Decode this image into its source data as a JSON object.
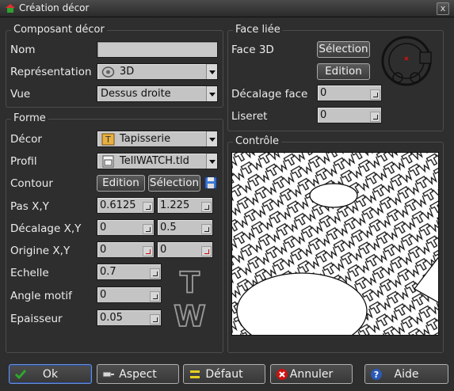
{
  "window": {
    "title": "Création décor",
    "close_label": "x"
  },
  "composant": {
    "legend": "Composant décor",
    "nom_label": "Nom",
    "nom_value": "",
    "representation_label": "Représentation",
    "representation_value": "3D",
    "vue_label": "Vue",
    "vue_value": "Dessus droite"
  },
  "forme": {
    "legend": "Forme",
    "decor_label": "Décor",
    "decor_value": "Tapisserie",
    "profil_label": "Profil",
    "profil_value": "TellWATCH.tld",
    "contour_label": "Contour",
    "edition_label": "Edition",
    "selection_label": "Sélection",
    "pas_label": "Pas X,Y",
    "pas_x": "0.6125",
    "pas_y": "1.225",
    "decalage_label": "Décalage X,Y",
    "decalage_x": "0",
    "decalage_y": "0.5",
    "origine_label": "Origine X,Y",
    "origine_x": "0",
    "origine_y": "0",
    "echelle_label": "Echelle",
    "echelle_value": "0.7",
    "angle_label": "Angle motif",
    "angle_value": "0",
    "epaisseur_label": "Epaisseur",
    "epaisseur_value": "0.05",
    "logo_letters": [
      "T",
      "W"
    ]
  },
  "face": {
    "legend": "Face liée",
    "face3d_label": "Face 3D",
    "selection_label": "Sélection",
    "edition_label": "Edition",
    "decalage_label": "Décalage face",
    "decalage_value": "0",
    "liseret_label": "Liseret",
    "liseret_value": "0"
  },
  "controle": {
    "legend": "Contrôle"
  },
  "buttons": {
    "ok": "Ok",
    "aspect": "Aspect",
    "defaut": "Défaut",
    "annuler": "Annuler",
    "aide": "Aide"
  },
  "colors": {
    "background": "#2e2e2e",
    "field": "#c4c4c4",
    "ok_icon": "#2ea82e",
    "cancel_icon": "#d01010",
    "help_icon": "#2a5ab8",
    "default_icon": "#e6d020"
  },
  "icons": [
    "app-icon",
    "close-icon",
    "3d-icon",
    "tapisserie-icon",
    "profil-icon",
    "save-icon",
    "face-preview-icon",
    "check-icon",
    "aspect-icon",
    "default-icon",
    "cancel-icon",
    "help-icon"
  ]
}
